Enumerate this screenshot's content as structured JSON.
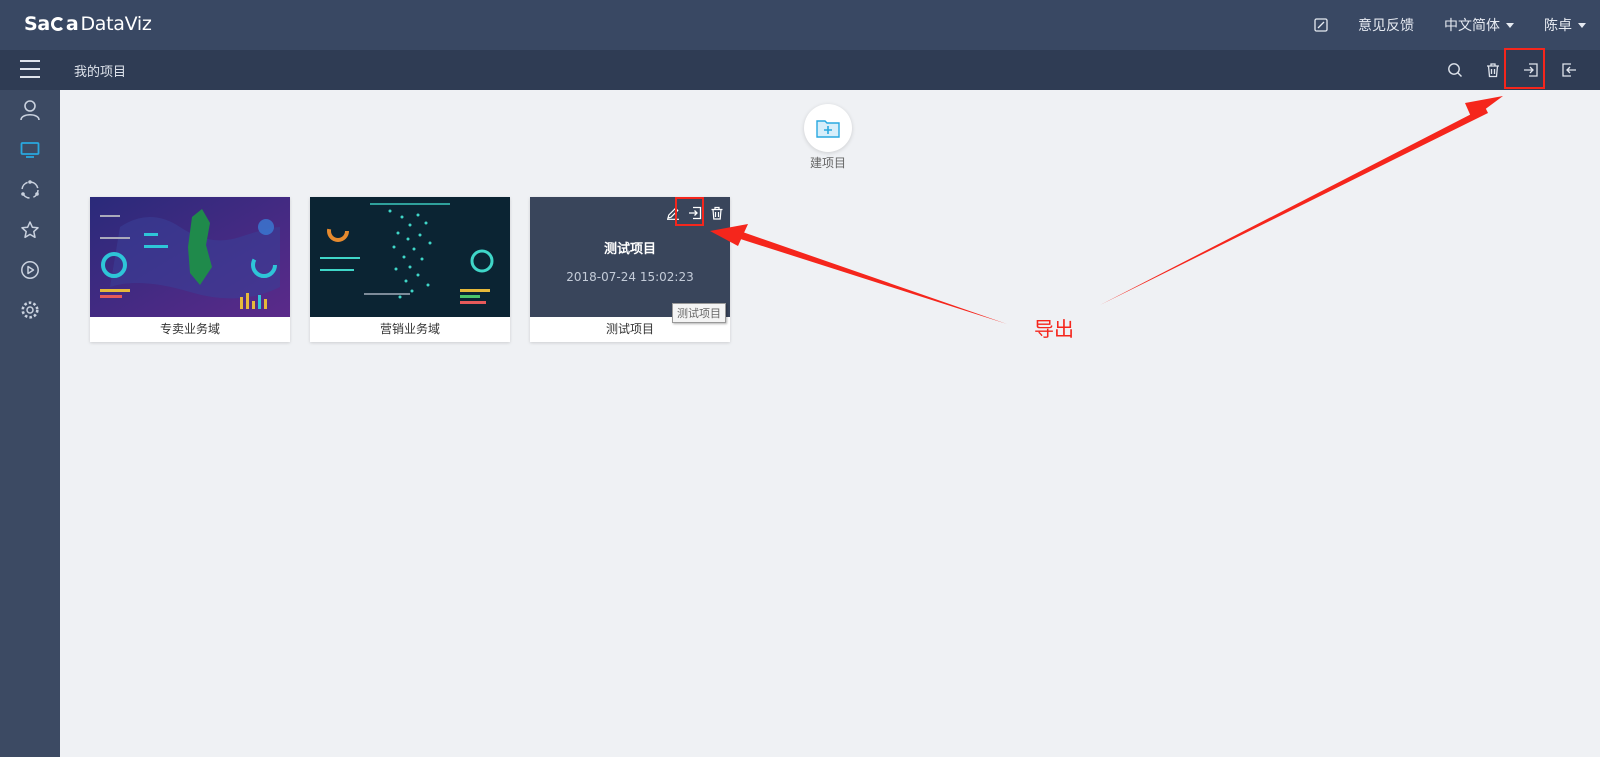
{
  "header": {
    "logo_sa": "Sa",
    "logo_a": "a",
    "logo_product": "DataViz",
    "feedback": "意见反馈",
    "language": "中文简体",
    "user": "陈卓"
  },
  "subheader": {
    "breadcrumb": "我的项目"
  },
  "icons": {
    "header": [
      "edit-square-icon"
    ],
    "subheader": [
      "search-icon",
      "trash-icon",
      "export-icon",
      "import-icon"
    ],
    "sidebar": [
      "user-icon",
      "monitor-icon",
      "share-circle-icon",
      "star-icon",
      "play-icon",
      "gear-icon"
    ]
  },
  "new_project": {
    "label": "建项目"
  },
  "projects": [
    {
      "name": "专卖业务域"
    },
    {
      "name": "营销业务域"
    },
    {
      "name": "测试项目",
      "overlay_title": "测试项目",
      "date": "2018-07-24 15:02:23",
      "tooltip": "测试项目"
    }
  ],
  "annotation": {
    "text": "导出",
    "color": "#f5261c"
  },
  "colors": {
    "topbar": "#394863",
    "subbar": "#2f3c54",
    "sidebar": "#3c4a63",
    "active": "#29a8e0",
    "highlight": "#f5261c"
  }
}
